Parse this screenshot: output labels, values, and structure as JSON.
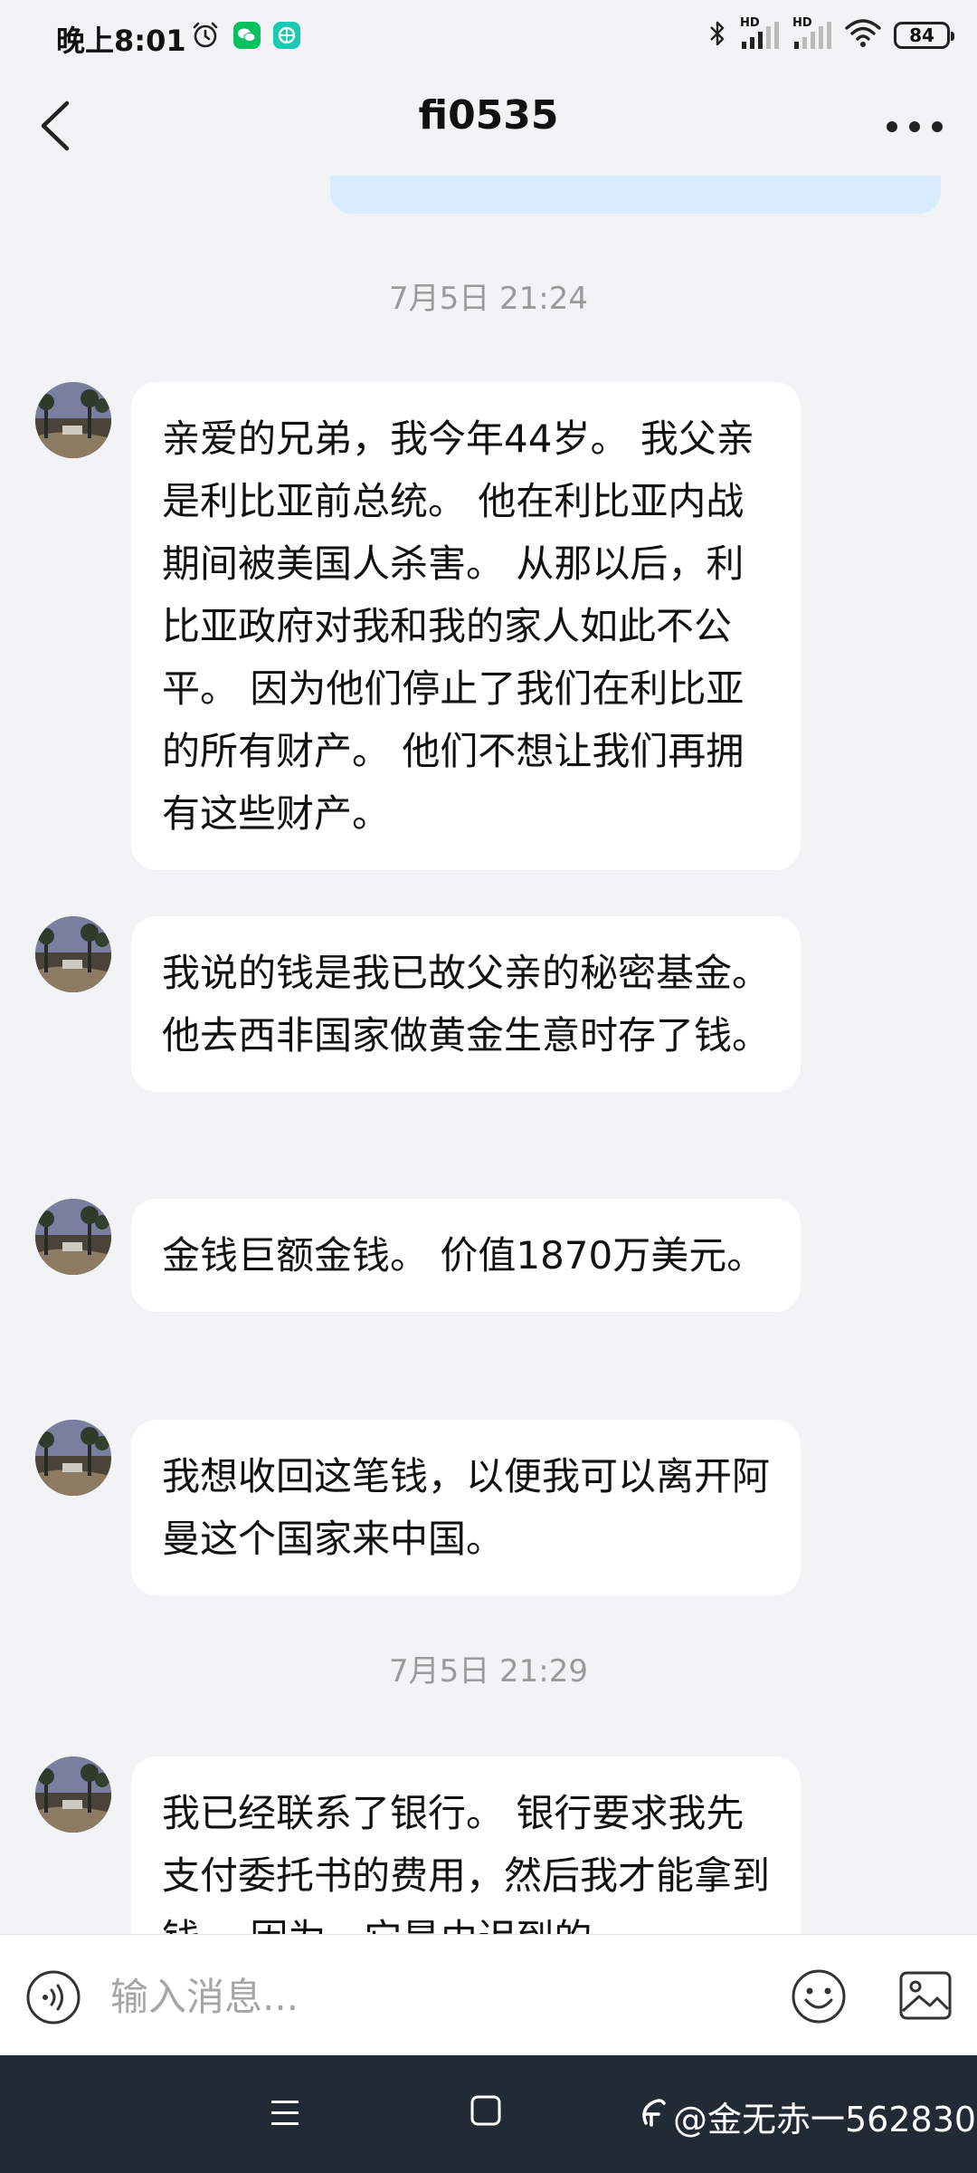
{
  "status_bar": {
    "time": "晚上8:01",
    "battery": "84",
    "hd_label_1": "HD",
    "hd_label_2": "HD"
  },
  "header": {
    "title": "fi0535"
  },
  "messages": [
    {
      "type": "timestamp",
      "text": "7月5日 21:24"
    },
    {
      "type": "incoming",
      "text": "亲爱的兄弟，我今年44岁。 我父亲是利比亚前总统。 他在利比亚内战期间被美国人杀害。 从那以后，利比亚政府对我和我的家人如此不公平。 因为他们停止了我们在利比亚的所有财产。 他们不想让我们再拥有这些财产。"
    },
    {
      "type": "incoming",
      "text": "我说的钱是我已故父亲的秘密基金。 他去西非国家做黄金生意时存了钱。"
    },
    {
      "type": "incoming",
      "text": "金钱巨额金钱。 价值1870万美元。"
    },
    {
      "type": "incoming",
      "text": "我想收回这笔钱，以便我可以离开阿曼这个国家来中国。"
    },
    {
      "type": "timestamp",
      "text": "7月5日 21:29"
    },
    {
      "type": "incoming",
      "text": "我已经联系了银行。 银行要求我先支付委托书的费用，然后我才能拿到钱。 因为，它是由迟到的"
    }
  ],
  "input": {
    "placeholder": "输入消息..."
  },
  "nav": {
    "watermark": "@金无赤一562830"
  },
  "colors": {
    "background": "#F2F3F5",
    "bubble": "#FFFFFF",
    "sent_bubble": "#D9EBFF",
    "timestamp_text": "#9A9A9A",
    "navbar": "#222A36"
  },
  "icons": {
    "back": "chevron-left-icon",
    "more": "more-dots-icon",
    "voice": "voice-icon",
    "emoji": "emoji-icon",
    "image": "image-icon",
    "alarm": "alarm-icon",
    "wechat": "wechat-icon",
    "app": "app-icon",
    "bluetooth": "bluetooth-icon",
    "signal": "signal-icon",
    "wifi": "wifi-icon"
  }
}
